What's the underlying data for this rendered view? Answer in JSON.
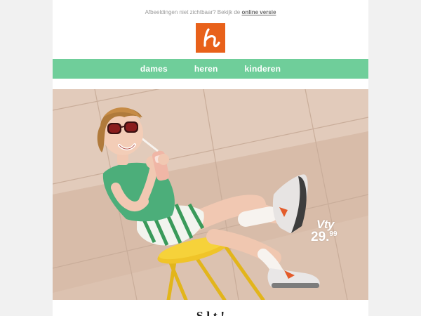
{
  "preheader": {
    "text": "Afbeeldingen niet zichtbaar? Bekijk de",
    "link_label": "online versie"
  },
  "logo": {
    "letter": "h",
    "color": "#e8611a"
  },
  "nav": {
    "color": "#6fce9a",
    "items": [
      {
        "label": "dames"
      },
      {
        "label": "heren"
      },
      {
        "label": "kinderen"
      }
    ]
  },
  "hero": {
    "price_badge": {
      "brand": "Vty",
      "price_main": "29.",
      "price_cents": "99"
    }
  },
  "headline": {
    "text": "S     l        t   !"
  }
}
